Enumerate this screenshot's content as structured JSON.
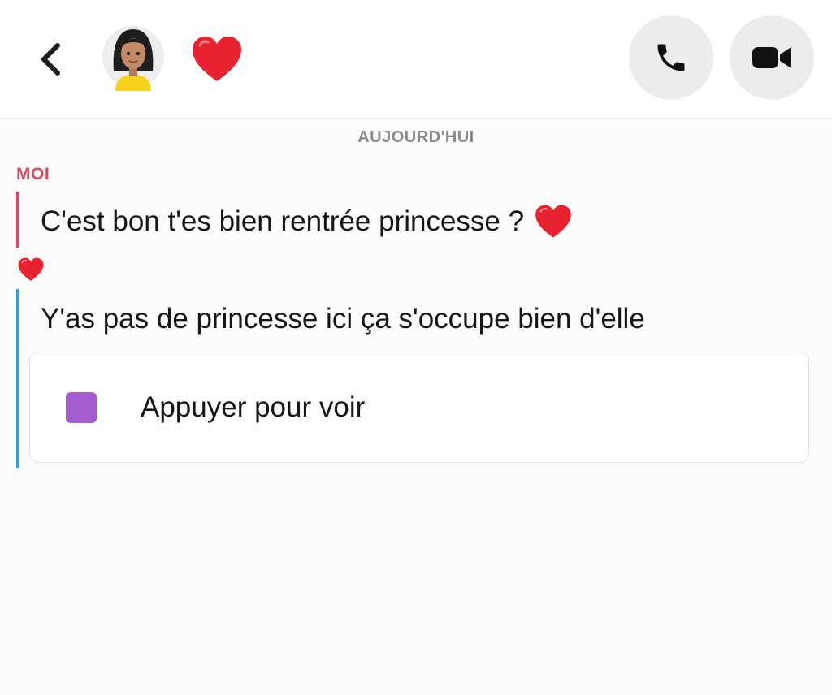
{
  "header": {
    "back_icon": "chevron-left-icon",
    "avatar_icon": "bitmoji-avatar",
    "status_emoji": "red-heart",
    "call_icon": "phone-icon",
    "video_icon": "video-camera-icon"
  },
  "chat": {
    "date_separator": "AUJOURD'HUI",
    "sender_me": "MOI",
    "message_me": "C'est bon t'es bien rentrée princesse ?",
    "reaction_emoji": "red-heart",
    "message_them": "Y'as pas de princesse ici ça s'occupe bien d'elle",
    "snap": {
      "label": "Appuyer pour voir",
      "icon_color": "#a45cd1"
    }
  },
  "colors": {
    "me_accent": "#e0455e",
    "them_accent": "#2e9de1",
    "heart": "#e8232f"
  }
}
